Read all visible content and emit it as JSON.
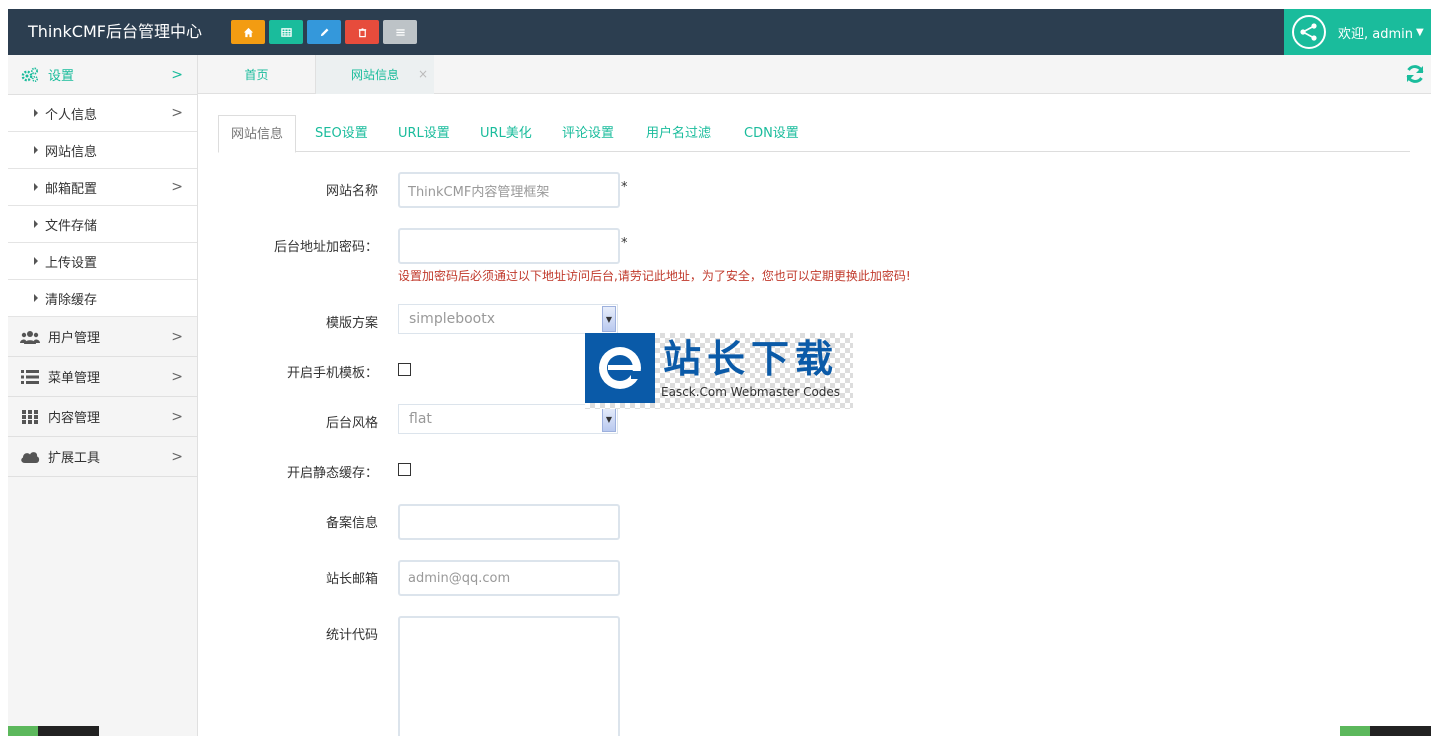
{
  "header": {
    "brand": "ThinkCMF后台管理中心",
    "shortcuts": [
      {
        "icon": "home-icon",
        "color": "#f39c12"
      },
      {
        "icon": "table-icon",
        "color": "#1abc9c"
      },
      {
        "icon": "pencil-icon",
        "color": "#3498db"
      },
      {
        "icon": "trash-icon",
        "color": "#e74c3c"
      },
      {
        "icon": "list-icon",
        "color": "#bdc3c7"
      }
    ],
    "welcome": "欢迎, admin"
  },
  "sidebar": {
    "settings": "设置",
    "sub_items": [
      "个人信息",
      "网站信息",
      "邮箱配置",
      "文件存储",
      "上传设置",
      "清除缓存"
    ],
    "user_mgmt": "用户管理",
    "menu_mgmt": "菜单管理",
    "content_mgmt": "内容管理",
    "ext_tools": "扩展工具"
  },
  "page_tabs": {
    "home": "首页",
    "current": "网站信息",
    "close": "×"
  },
  "content_tabs": [
    "网站信息",
    "SEO设置",
    "URL设置",
    "URL美化",
    "评论设置",
    "用户名过滤",
    "CDN设置"
  ],
  "form": {
    "site_name_label": "网站名称",
    "site_name_value": "ThinkCMF内容管理框架",
    "admin_key_label": "后台地址加密码：",
    "admin_key_hint": "设置加密码后必须通过以下地址访问后台,请劳记此地址，为了安全，您也可以定期更换此加密码!",
    "required_mark": "*",
    "template_label": "模版方案",
    "template_value": "simplebootx",
    "mobile_tpl_label": "开启手机模板：",
    "admin_style_label": "后台风格",
    "admin_style_value": "flat",
    "static_cache_label": "开启静态缓存：",
    "icp_label": "备案信息",
    "icp_value": "",
    "email_label": "站长邮箱",
    "email_value": "admin@qq.com",
    "stats_label": "统计代码",
    "stats_value": ""
  },
  "watermark": {
    "title": "站长下载",
    "subtitle": "Easck.Com Webmaster Codes"
  },
  "colors": {
    "header_bg": "#2c3e50",
    "accent": "#1abc9c",
    "hint_red": "#c0392b"
  }
}
